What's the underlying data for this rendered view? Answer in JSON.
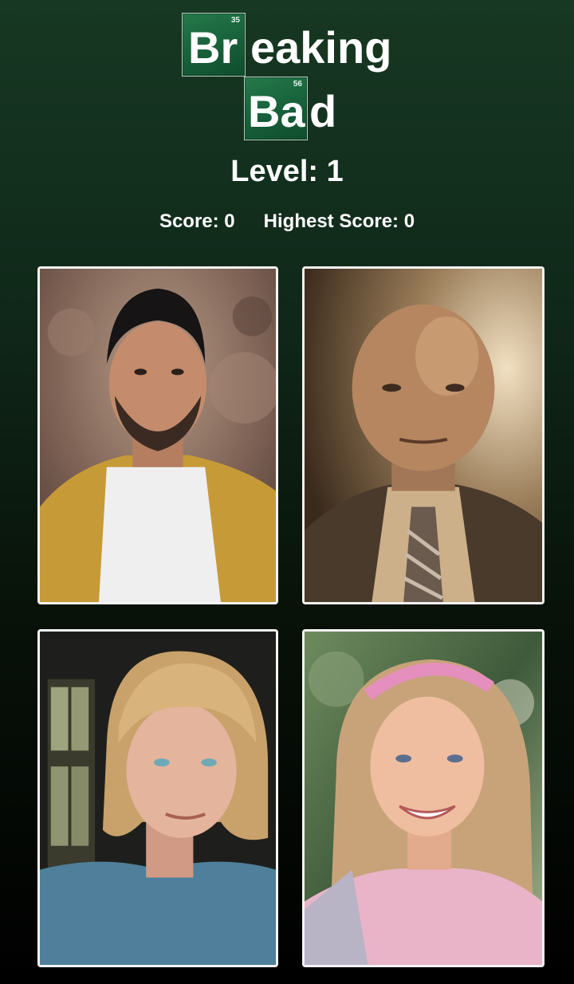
{
  "logo": {
    "element1_number": "35",
    "element1_symbol": "Br",
    "word1_rest": "eaking",
    "element2_number": "56",
    "element2_symbol": "Ba",
    "word2_rest": "d"
  },
  "game": {
    "level_label": "Level: 1",
    "score_label": "Score: 0",
    "highest_label": "Highest Score: 0"
  },
  "cards": [
    {
      "image": "young-man-yellow-jacket-portrait"
    },
    {
      "image": "bald-man-suit-tie-portrait"
    },
    {
      "image": "blonde-woman-blue-sweater-portrait"
    },
    {
      "image": "girl-pink-headband-portrait"
    }
  ]
}
